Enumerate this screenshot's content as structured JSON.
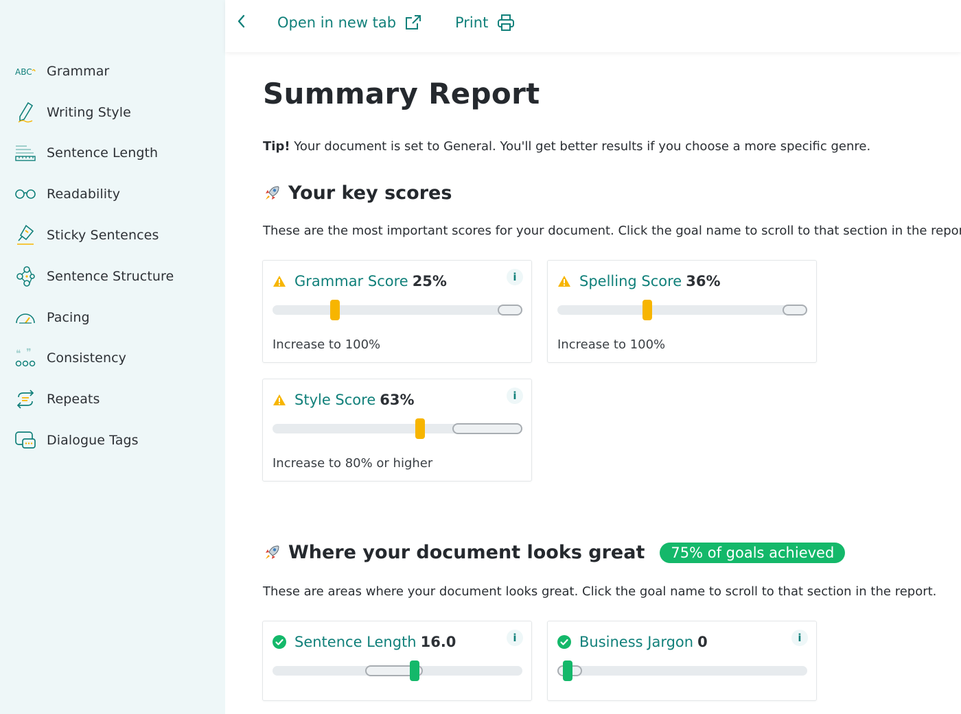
{
  "colors": {
    "accent": "#11807a",
    "warning": "#f7b500",
    "success": "#14b86a",
    "sidebar_bg": "#eef7f8"
  },
  "sidebar": {
    "items": [
      {
        "label": "Grammar",
        "icon": "abc-icon"
      },
      {
        "label": "Writing Style",
        "icon": "pen-icon"
      },
      {
        "label": "Sentence Length",
        "icon": "ruler-icon"
      },
      {
        "label": "Readability",
        "icon": "glasses-icon"
      },
      {
        "label": "Sticky Sentences",
        "icon": "glue-icon"
      },
      {
        "label": "Sentence Structure",
        "icon": "structure-icon"
      },
      {
        "label": "Pacing",
        "icon": "gauge-icon"
      },
      {
        "label": "Consistency",
        "icon": "quotes-icon"
      },
      {
        "label": "Repeats",
        "icon": "repeat-icon"
      },
      {
        "label": "Dialogue Tags",
        "icon": "speech-bubble-icon"
      }
    ]
  },
  "toolbar": {
    "open_tab_label": "Open in new tab",
    "print_label": "Print"
  },
  "page": {
    "title": "Summary Report",
    "tip_bold": "Tip!",
    "tip_text": " Your document is set to General. You'll get better results if you choose a more specific genre."
  },
  "key_scores": {
    "heading": "Your key scores",
    "description": "These are the most important scores for your document. Click the goal name to scroll to that section in the report.",
    "cards": [
      {
        "name": "Grammar Score",
        "value": "25%",
        "footer": "Increase to 100%",
        "status": "warning",
        "level": 0.25,
        "target_from": 0.9,
        "target_to": 1.0
      },
      {
        "name": "Spelling Score",
        "value": "36%",
        "footer": "Increase to 100%",
        "status": "warning",
        "level": 0.36,
        "target_from": 0.9,
        "target_to": 1.0
      },
      {
        "name": "Style Score",
        "value": "63%",
        "footer": "Increase to 80% or higher",
        "status": "warning",
        "level": 0.59,
        "target_from": 0.72,
        "target_to": 1.0
      }
    ]
  },
  "looks_great": {
    "heading": "Where your document looks great",
    "badge": "75% of goals achieved",
    "description": "These are areas where your document looks great. Click the goal name to scroll to that section in the report.",
    "cards": [
      {
        "name": "Sentence Length",
        "value": "16.0",
        "status": "success",
        "level": 0.57,
        "target_from": 0.37,
        "target_to": 0.6
      },
      {
        "name": "Business Jargon",
        "value": "0",
        "status": "success",
        "level": 0.04,
        "target_from": 0.0,
        "target_to": 0.1
      }
    ]
  }
}
